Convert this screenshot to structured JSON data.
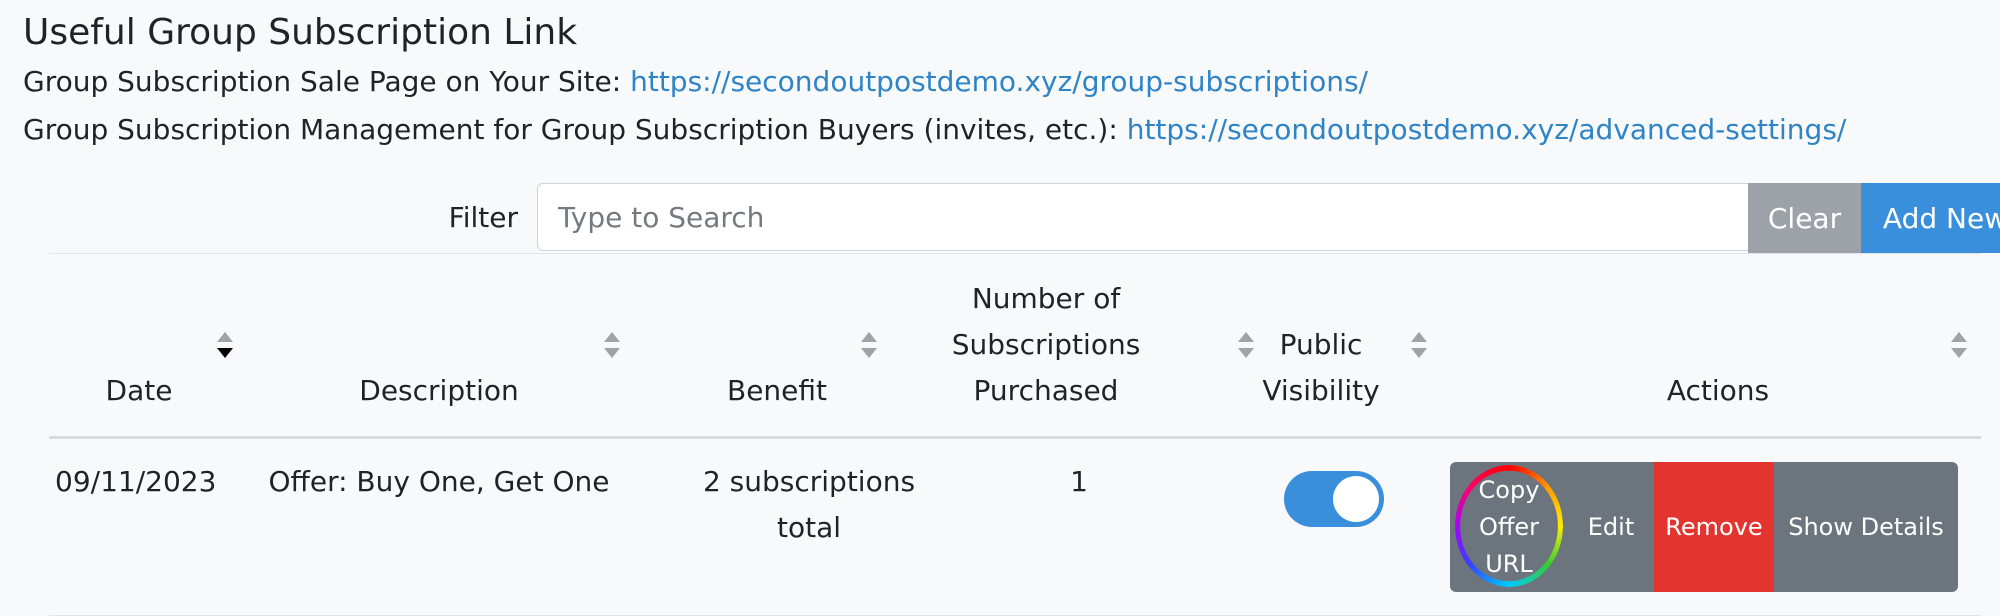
{
  "links": {
    "title": "Useful Group Subscription Link",
    "sale_page_label": "Group Subscription Sale Page on Your Site: ",
    "sale_page_url": "https://secondoutpostdemo.xyz/group-subscriptions/",
    "management_label": "Group Subscription Management for Group Subscription Buyers (invites, etc.): ",
    "management_url": "https://secondoutpostdemo.xyz/advanced-settings/"
  },
  "filter": {
    "label": "Filter",
    "placeholder": "Type to Search",
    "value": "",
    "clear_label": "Clear",
    "add_new_label": "Add New"
  },
  "table": {
    "headers": {
      "date": "Date",
      "description": "Description",
      "benefit": "Benefit",
      "subs_line1": "Number of",
      "subs_line2": "Subscriptions",
      "subs_line3": "Purchased",
      "visibility_line1": "Public",
      "visibility_line2": "Visibility",
      "actions": "Actions"
    },
    "sorted_column": "date",
    "rows": [
      {
        "date": "09/11/2023",
        "description": "Offer: Buy One, Get One",
        "benefit_line1": "2 subscriptions",
        "benefit_line2": "total",
        "subscriptions": "1",
        "public_visibility": true
      }
    ],
    "actions": {
      "copy_line1": "Copy",
      "copy_line2": "Offer",
      "copy_line3": "URL",
      "edit": "Edit",
      "remove": "Remove",
      "details": "Show Details"
    }
  },
  "colors": {
    "link": "#2f84c6",
    "primary": "#3a8fdd",
    "secondary": "#6c757d",
    "clear": "#9ca2a8",
    "danger": "#e3342f",
    "background": "#f8f9fb"
  }
}
